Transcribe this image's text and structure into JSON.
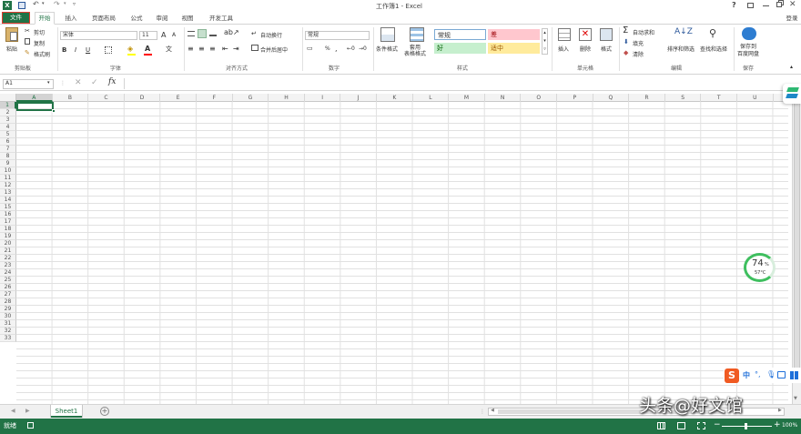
{
  "window": {
    "title": "工作簿1 - Excel",
    "help": "?",
    "login": "登录"
  },
  "tabs": [
    "文件",
    "开始",
    "插入",
    "页面布局",
    "公式",
    "审阅",
    "视图",
    "开发工具"
  ],
  "clipboard": {
    "paste": "粘贴",
    "cut": "剪切",
    "copy": "复制",
    "format_painter": "格式刷",
    "label": "剪贴板"
  },
  "font": {
    "name": "宋体",
    "size": "11",
    "grow": "A",
    "shrink": "A",
    "bold": "B",
    "italic": "I",
    "underline": "U",
    "label": "字体"
  },
  "alignment": {
    "wrap": "自动换行",
    "merge": "合并后居中",
    "label": "对齐方式"
  },
  "number": {
    "format": "常规",
    "percent": "%",
    "comma": ",",
    "label": "数字"
  },
  "styles": {
    "conditional": "条件格式",
    "table": "套用\n表格格式",
    "normal": "常规",
    "bad": "差",
    "good": "好",
    "neutral": "适中",
    "label": "样式"
  },
  "cells": {
    "insert": "插入",
    "delete": "删除",
    "format": "格式",
    "label": "单元格"
  },
  "editing": {
    "autosum": "自动求和",
    "fill": "填充",
    "clear": "清除",
    "sort": "排序和筛选",
    "find": "查找和选择",
    "label": "编辑"
  },
  "save": {
    "baidu": "保存到\n百度网盘",
    "label": "保存"
  },
  "formula_bar": {
    "name_box": "A1",
    "fx": "fx",
    "value": ""
  },
  "columns": [
    "A",
    "B",
    "C",
    "D",
    "E",
    "F",
    "G",
    "H",
    "I",
    "J",
    "K",
    "L",
    "M",
    "N",
    "O",
    "P",
    "Q",
    "R",
    "S",
    "T",
    "U"
  ],
  "rows": [
    "1",
    "2",
    "3",
    "4",
    "5",
    "6",
    "7",
    "8",
    "9",
    "10",
    "11",
    "12",
    "13",
    "14",
    "15",
    "16",
    "17",
    "18",
    "19",
    "20",
    "21",
    "22",
    "23",
    "24",
    "25",
    "26",
    "27",
    "28",
    "29",
    "30",
    "31",
    "32",
    "33"
  ],
  "sheets": [
    "Sheet1"
  ],
  "status": {
    "ready": "就绪",
    "zoom": "100%"
  },
  "widget": {
    "percent": "74",
    "temp": "57°C"
  },
  "watermark": "头条@好文馆",
  "colors": {
    "excel_green": "#217346",
    "good": "#c6efce",
    "bad": "#ffc7ce",
    "neutral": "#ffeb9c",
    "normal": "#ffffff",
    "selection": "#217346"
  }
}
